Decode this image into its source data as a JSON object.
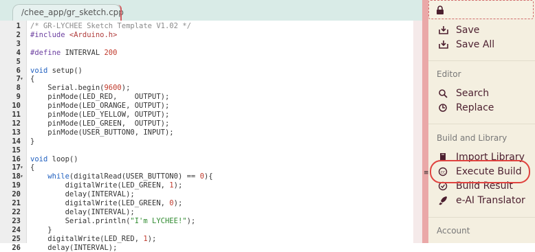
{
  "tab": {
    "label": "/chee_app/gr_sketch.cpp"
  },
  "editor": {
    "lines": [
      {
        "n": "1",
        "fold": "",
        "html": "<span class=\"c-comment\">/* GR-LYCHEE Sketch Template V1.02 */</span>"
      },
      {
        "n": "2",
        "fold": "",
        "html": "<span class=\"c-pre\">#include</span> <span class=\"c-inc\">&lt;Arduino.h&gt;</span>"
      },
      {
        "n": "3",
        "fold": "",
        "html": ""
      },
      {
        "n": "4",
        "fold": "",
        "html": "<span class=\"c-pre\">#define</span> INTERVAL <span class=\"c-num\">200</span>"
      },
      {
        "n": "5",
        "fold": "",
        "html": ""
      },
      {
        "n": "6",
        "fold": "",
        "html": "<span class=\"c-kw\">void</span> setup()"
      },
      {
        "n": "7",
        "fold": "▾",
        "html": "{"
      },
      {
        "n": "8",
        "fold": "",
        "html": "    Serial.begin(<span class=\"c-num\">9600</span>);"
      },
      {
        "n": "9",
        "fold": "",
        "html": "    pinMode(LED_RED,    OUTPUT);"
      },
      {
        "n": "10",
        "fold": "",
        "html": "    pinMode(LED_ORANGE, OUTPUT);"
      },
      {
        "n": "11",
        "fold": "",
        "html": "    pinMode(LED_YELLOW, OUTPUT);"
      },
      {
        "n": "12",
        "fold": "",
        "html": "    pinMode(LED_GREEN,  OUTPUT);"
      },
      {
        "n": "13",
        "fold": "",
        "html": "    pinMode(USER_BUTTON0, INPUT);"
      },
      {
        "n": "14",
        "fold": "",
        "html": "}"
      },
      {
        "n": "15",
        "fold": "",
        "html": ""
      },
      {
        "n": "16",
        "fold": "",
        "html": "<span class=\"c-kw\">void</span> loop()"
      },
      {
        "n": "17",
        "fold": "▾",
        "html": "{"
      },
      {
        "n": "18",
        "fold": "▾",
        "html": "    <span class=\"c-kw\">while</span>(digitalRead(USER_BUTTON0) == <span class=\"c-num\">0</span>){"
      },
      {
        "n": "19",
        "fold": "",
        "html": "        digitalWrite(LED_GREEN, <span class=\"c-num\">1</span>);"
      },
      {
        "n": "20",
        "fold": "",
        "html": "        delay(INTERVAL);"
      },
      {
        "n": "21",
        "fold": "",
        "html": "        digitalWrite(LED_GREEN, <span class=\"c-num\">0</span>);"
      },
      {
        "n": "22",
        "fold": "",
        "html": "        delay(INTERVAL);"
      },
      {
        "n": "23",
        "fold": "",
        "html": "        Serial.println(<span class=\"c-str\">\"I'm LYCHEE!\"</span>);"
      },
      {
        "n": "24",
        "fold": "",
        "html": "    }"
      },
      {
        "n": "25",
        "fold": "",
        "html": "    digitalWrite(LED_RED, <span class=\"c-num\">1</span>);"
      },
      {
        "n": "26",
        "fold": "",
        "html": "    delay(INTERVAL);"
      }
    ]
  },
  "sidebar": {
    "lock_icon": "lock-icon",
    "file_items": [
      {
        "label": "Save",
        "icon": "save-icon"
      },
      {
        "label": "Save All",
        "icon": "save-all-icon"
      }
    ],
    "editor_section": "Editor",
    "editor_items": [
      {
        "label": "Search",
        "icon": "search-icon"
      },
      {
        "label": "Replace",
        "icon": "replace-icon"
      }
    ],
    "build_section": "Build and Library",
    "build_items": [
      {
        "label": "Import Library",
        "icon": "book-icon"
      },
      {
        "label": "Execute Build",
        "icon": "build-icon"
      },
      {
        "label": "Build Result",
        "icon": "result-icon"
      },
      {
        "label": "e-AI Translator",
        "icon": "rocket-icon"
      }
    ],
    "account_section": "Account"
  },
  "colors": {
    "accent": "#4c1f2f",
    "highlight_circle": "#e0433f",
    "sidebar_bg": "#f4efe0",
    "tab_bg": "#d9ebe7"
  }
}
